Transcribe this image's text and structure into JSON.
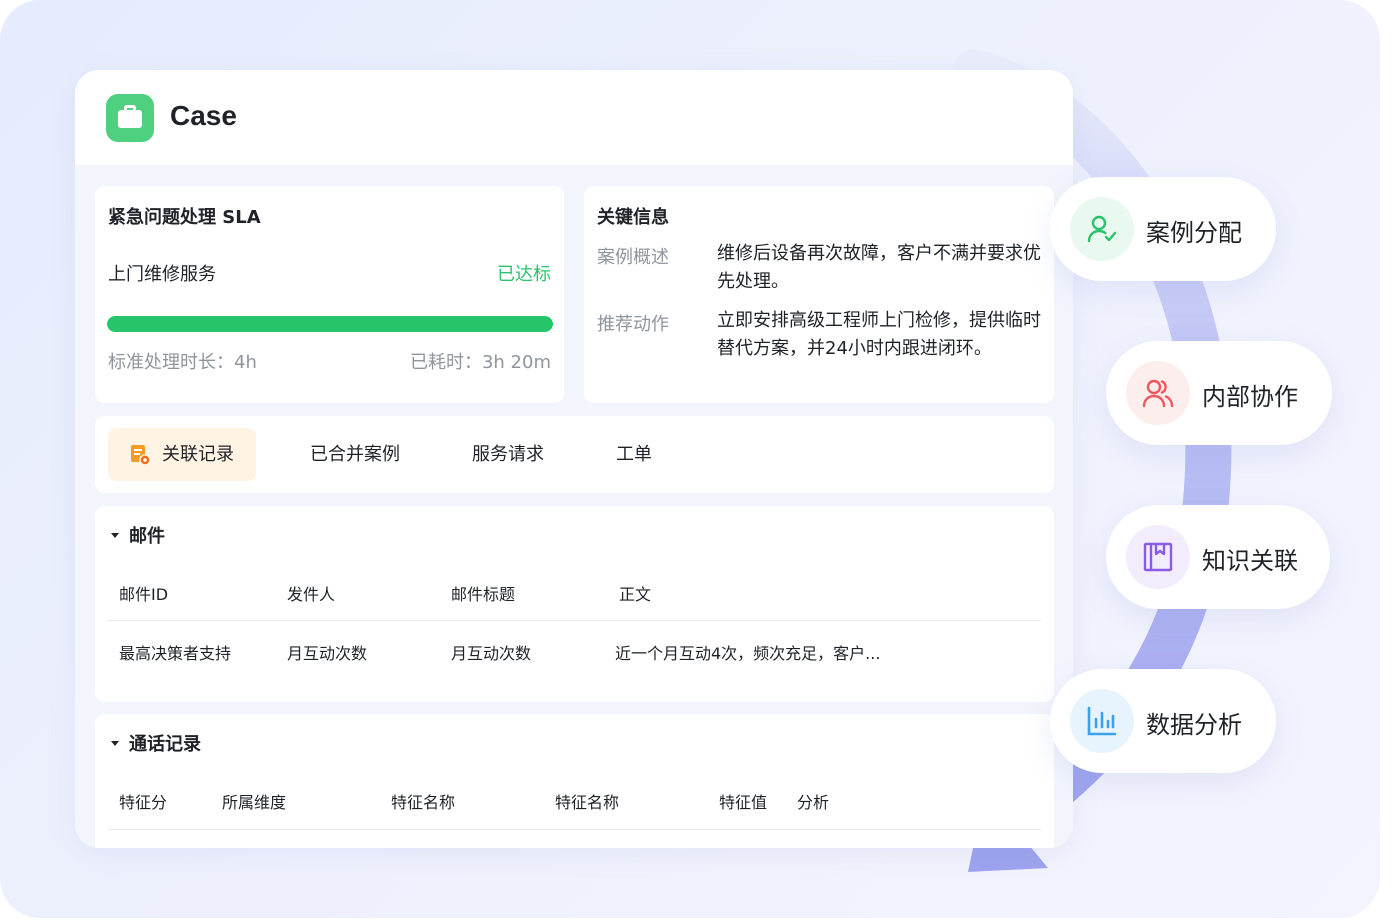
{
  "header": {
    "title": "Case"
  },
  "sla": {
    "title": "紧急问题处理 SLA",
    "service": "上门维修服务",
    "status": "已达标",
    "progress": 1.0,
    "standard": "标准处理时长：4h",
    "elapsed": "已耗时：3h 20m",
    "color": "#27c56a"
  },
  "info": {
    "title": "关键信息",
    "rows": [
      {
        "key": "案例概述",
        "value": "维修后设备再次故障，客户不满并要求优先处理。"
      },
      {
        "key": "推荐动作",
        "value": "立即安排高级工程师上门检修，提供临时替代方案，并24小时内跟进闭环。"
      }
    ]
  },
  "tabs": [
    {
      "label": "关联记录",
      "active": true
    },
    {
      "label": "已合并案例"
    },
    {
      "label": "服务请求"
    },
    {
      "label": "工单"
    }
  ],
  "mail": {
    "title": "邮件",
    "columns": [
      "邮件ID",
      "发件人",
      "邮件标题",
      "正文"
    ],
    "rows": [
      [
        "最高决策者支持",
        "月互动次数",
        "月互动次数",
        "近一个月互动4次，频次充足，客户..."
      ]
    ]
  },
  "calls": {
    "title": "通话记录",
    "columns": [
      "特征分",
      "所属维度",
      "特征名称",
      "特征名称",
      "特征值",
      "分析"
    ]
  },
  "features": [
    {
      "label": "案例分配",
      "icon": "user-check-icon",
      "color": "#2ec26e"
    },
    {
      "label": "内部协作",
      "icon": "users-icon",
      "color": "#f0565b"
    },
    {
      "label": "知识关联",
      "icon": "book-icon",
      "color": "#8a5ce6"
    },
    {
      "label": "数据分析",
      "icon": "bar-chart-icon",
      "color": "#3aa0f0"
    }
  ]
}
